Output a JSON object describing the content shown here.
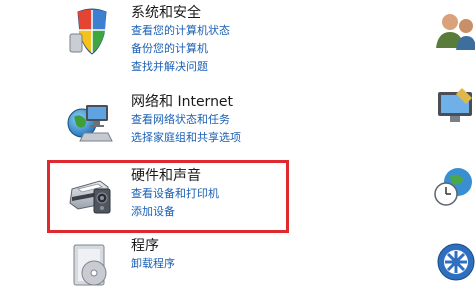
{
  "categories": [
    {
      "title": "系统和安全",
      "icon": "shield-icon",
      "links": [
        "查看您的计算机状态",
        "备份您的计算机",
        "查找并解决问题"
      ]
    },
    {
      "title": "网络和 Internet",
      "icon": "network-globe-icon",
      "links": [
        "查看网络状态和任务",
        "选择家庭组和共享选项"
      ]
    },
    {
      "title": "硬件和声音",
      "icon": "printer-speaker-icon",
      "links": [
        "查看设备和打印机",
        "添加设备"
      ]
    },
    {
      "title": "程序",
      "icon": "programs-icon",
      "links": [
        "卸载程序"
      ]
    }
  ],
  "colors": {
    "link": "#1a5fb4",
    "title": "#1a1a1a",
    "highlight": "#e0292e"
  }
}
